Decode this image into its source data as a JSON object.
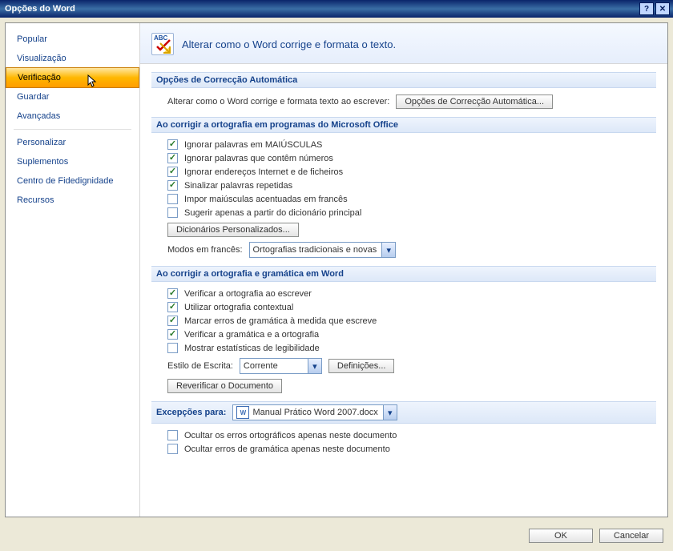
{
  "title": "Opções do Word",
  "sidebar": {
    "items": [
      {
        "label": "Popular"
      },
      {
        "label": "Visualização"
      },
      {
        "label": "Verificação"
      },
      {
        "label": "Guardar"
      },
      {
        "label": "Avançadas"
      },
      {
        "label": "Personalizar"
      },
      {
        "label": "Suplementos"
      },
      {
        "label": "Centro de Fidedignidade"
      },
      {
        "label": "Recursos"
      }
    ]
  },
  "header": {
    "icon_text": "ABC",
    "text": "Alterar como o Word corrige e formata o texto."
  },
  "s1": {
    "title": "Opções de Correcção Automática",
    "desc": "Alterar como o Word corrige e formata texto ao escrever:",
    "btn": "Opções de Correcção Automática..."
  },
  "s2": {
    "title": "Ao corrigir a ortografia em programas do Microsoft Office",
    "o1": "Ignorar palavras em MAIÚSCULAS",
    "o2": "Ignorar palavras que contêm números",
    "o3": "Ignorar endereços Internet e de ficheiros",
    "o4": "Sinalizar palavras repetidas",
    "o5": "Impor maiúsculas acentuadas em francês",
    "o6": "Sugerir apenas a partir do dicionário principal",
    "btn_dict": "Dicionários Personalizados...",
    "modes_label": "Modos em francês:",
    "modes_value": "Ortografias tradicionais e novas"
  },
  "s3": {
    "title": "Ao corrigir a ortografia e gramática em Word",
    "o1": "Verificar a ortografia ao escrever",
    "o2": "Utilizar ortografia contextual",
    "o3": "Marcar erros de gramática à medida que escreve",
    "o4": "Verificar a gramática e a ortografia",
    "o5": "Mostrar estatísticas de legibilidade",
    "style_label": "Estilo de Escrita:",
    "style_value": "Corrente",
    "btn_def": "Definições...",
    "btn_recheck": "Reverificar o Documento"
  },
  "s4": {
    "title": "Excepções para:",
    "doc_value": "Manual Prático Word 2007.docx",
    "o1": "Ocultar os erros ortográficos apenas neste documento",
    "o2": "Ocultar erros de gramática apenas neste documento"
  },
  "footer": {
    "ok": "OK",
    "cancel": "Cancelar"
  }
}
